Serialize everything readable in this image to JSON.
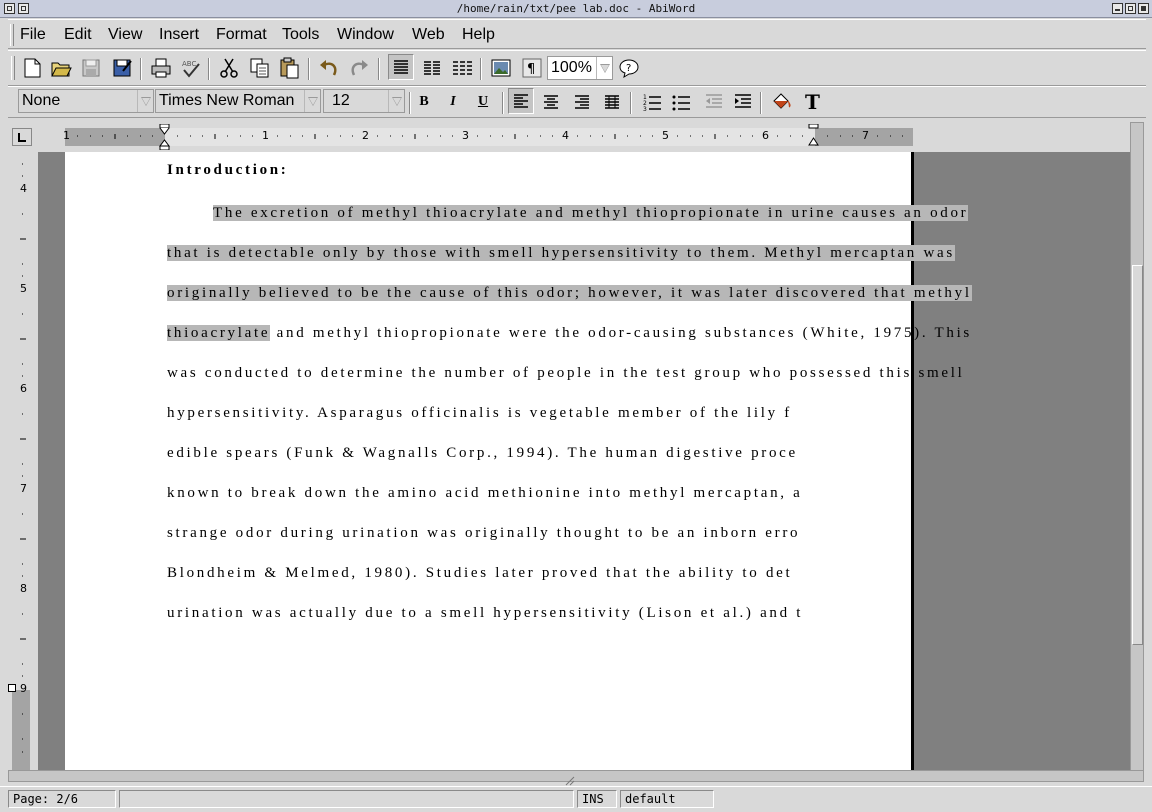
{
  "window": {
    "title": "/home/rain/txt/pee lab.doc - AbiWord"
  },
  "menu": {
    "items": [
      "File",
      "Edit",
      "View",
      "Insert",
      "Format",
      "Tools",
      "Window",
      "Web",
      "Help"
    ]
  },
  "toolbar": {
    "icons": [
      "new-document",
      "open-folder",
      "save",
      "save-as",
      "print",
      "spell-check",
      "cut",
      "copy",
      "paste",
      "undo",
      "redo",
      "align-left-block",
      "columns-two",
      "columns-three",
      "insert-image",
      "pilcrow",
      "help"
    ],
    "zoom": "100%"
  },
  "format_toolbar": {
    "style": "None",
    "font": "Times New Roman",
    "size": "12",
    "bold": "B",
    "italic": "I",
    "underline": "U"
  },
  "ruler": {
    "horizontal_numbers": [
      "1",
      "1",
      "2",
      "3",
      "4",
      "5",
      "6",
      "7"
    ],
    "vertical_numbers": [
      "4",
      "5",
      "6",
      "7",
      "8",
      "9"
    ]
  },
  "document": {
    "heading": "Introduction:",
    "lines": [
      "The excretion of methyl thioacrylate and methyl thiopropionate in urine causes an odor",
      "that is detectable only by those with smell hypersensitivity to them.  Methyl mercaptan was",
      "originally believed to be the cause of this odor; however, it was later discovered that methyl",
      "thioacrylate",
      " and methyl thiopropionate were the odor-causing substances (White, 1975).  This",
      "was conducted to determine the number of people in the test group who possessed this smell",
      "hypersensitivity.  Asparagus officinalis is vegetable member of the lily f",
      "edible spears (Funk & Wagnalls Corp., 1994). The human digestive proce",
      "known to break down the amino acid methionine into methyl mercaptan, a",
      "strange odor during urination was originally thought to be an inborn erro",
      "Blondheim & Melmed, 1980).  Studies later proved that the ability to det",
      "urination was actually due to a smell hypersensitivity (Lison et al.) and t"
    ]
  },
  "status": {
    "page": "Page: 2/6",
    "blank": "",
    "mode": "INS",
    "language": "default"
  }
}
